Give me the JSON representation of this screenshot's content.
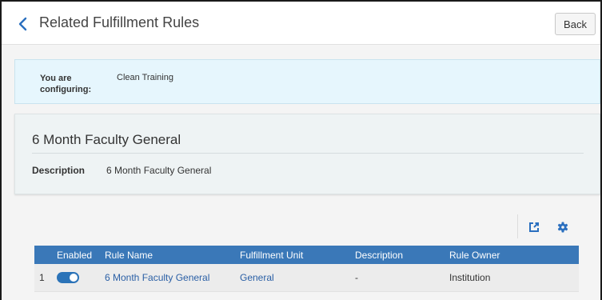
{
  "header": {
    "title": "Related Fulfillment Rules",
    "back_button_label": "Back"
  },
  "config": {
    "label": "You are configuring:",
    "value": "Clean Training"
  },
  "rule": {
    "title": "6 Month Faculty General",
    "description_label": "Description",
    "description_value": "6 Month Faculty General"
  },
  "toolbar": {
    "export_icon": "export-icon",
    "settings_icon": "gear-icon"
  },
  "table": {
    "columns": [
      "",
      "Enabled",
      "Rule Name",
      "Fulfillment Unit",
      "Description",
      "Rule Owner"
    ],
    "rows": [
      {
        "index": "1",
        "enabled": true,
        "rule_name": "6 Month Faculty General",
        "fulfillment_unit": "General",
        "description": "-",
        "rule_owner": "Institution"
      }
    ]
  },
  "colors": {
    "accent": "#3a78b8",
    "link": "#2a5fa5",
    "config_bg": "#e6f6fd"
  }
}
